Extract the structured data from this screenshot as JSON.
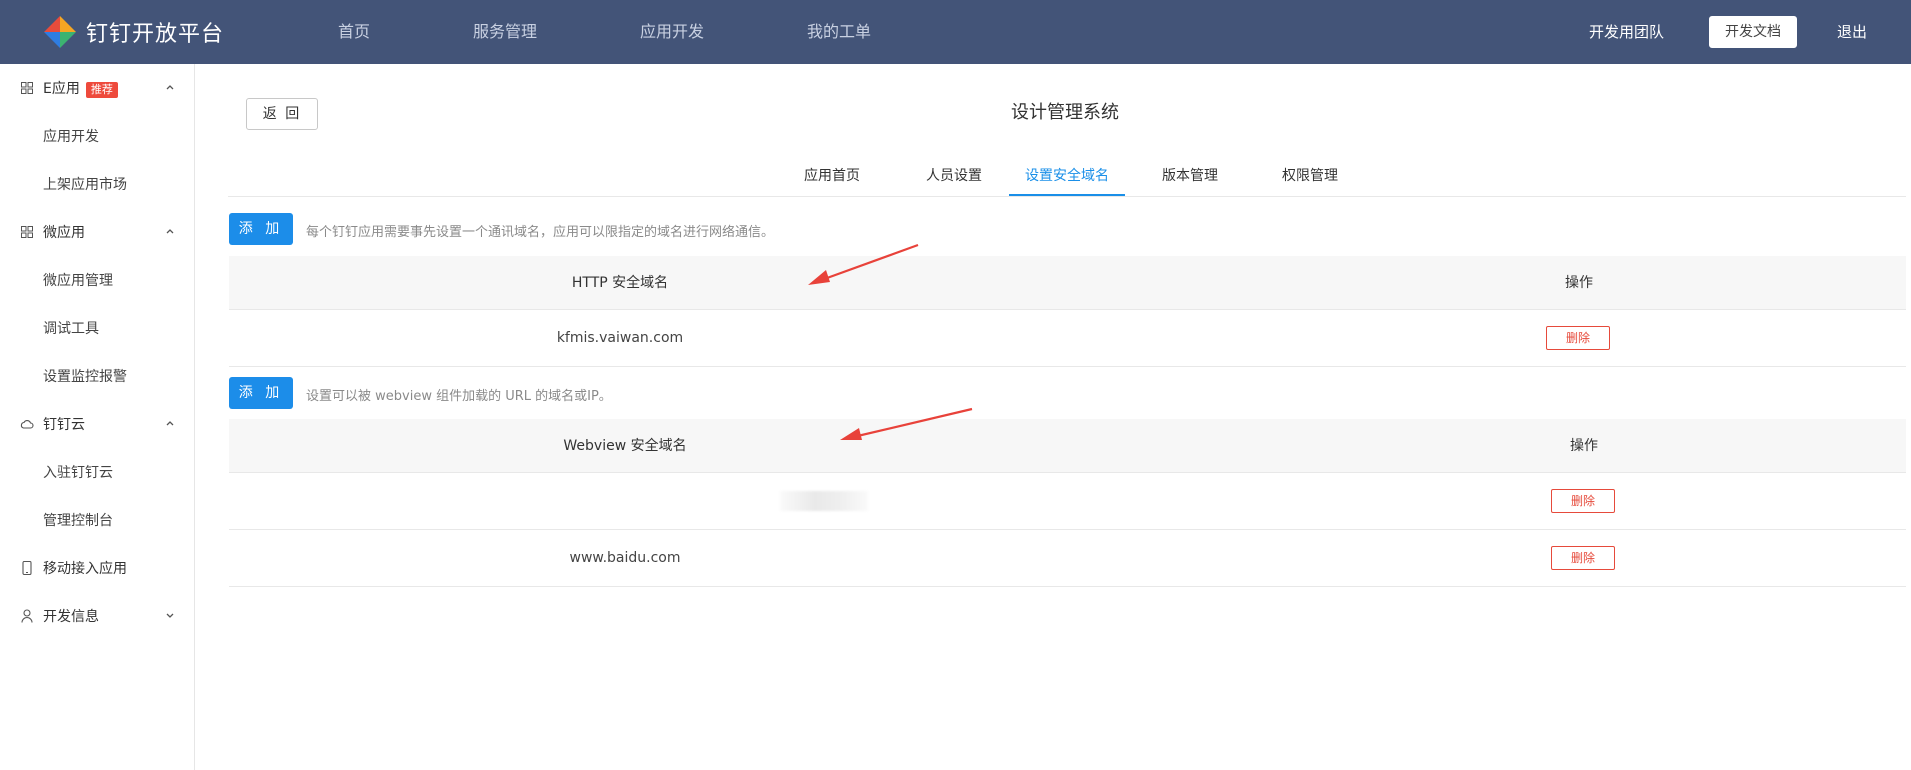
{
  "header": {
    "logo_text": "钉钉开放平台",
    "nav": [
      "首页",
      "服务管理",
      "应用开发",
      "我的工单"
    ],
    "team": "开发用团队",
    "docs_button": "开发文档",
    "logout": "退出"
  },
  "sidebar": {
    "eapp": {
      "label": "E应用",
      "badge": "推荐",
      "icon": "grid-icon",
      "children": [
        "应用开发",
        "上架应用市场"
      ]
    },
    "microapp": {
      "label": "微应用",
      "icon": "grid-icon",
      "children": [
        "微应用管理",
        "调试工具",
        "设置监控报警"
      ]
    },
    "dingcloud": {
      "label": "钉钉云",
      "icon": "cloud-icon",
      "children": [
        "入驻钉钉云",
        "管理控制台"
      ]
    },
    "mobile": {
      "label": "移动接入应用",
      "icon": "mobile-icon"
    },
    "devinfo": {
      "label": "开发信息",
      "icon": "user-icon"
    }
  },
  "main": {
    "back_button": "返 回",
    "app_title": "设计管理系统",
    "tabs": [
      "应用首页",
      "人员设置",
      "设置安全域名",
      "版本管理",
      "权限管理"
    ],
    "active_tab": "设置安全域名",
    "http_section": {
      "add_button": "添 加",
      "hint": "每个钉钉应用需要事先设置一个通讯域名，应用可以限指定的域名进行网络通信。",
      "columns": [
        "HTTP 安全域名",
        "操作"
      ],
      "rows": [
        {
          "domain": "kfmis.vaiwan.com",
          "action": "删除"
        }
      ]
    },
    "webview_section": {
      "add_button": "添 加",
      "hint": "设置可以被 webview 组件加载的 URL 的域名或IP。",
      "columns": [
        "Webview 安全域名",
        "操作"
      ],
      "rows": [
        {
          "domain": "",
          "action": "删除"
        },
        {
          "domain": "www.baidu.com",
          "action": "删除"
        }
      ]
    }
  },
  "colors": {
    "header_bg": "#435478",
    "primary": "#1c8de9",
    "danger": "#e64a3b",
    "arrow": "#e8423a"
  }
}
